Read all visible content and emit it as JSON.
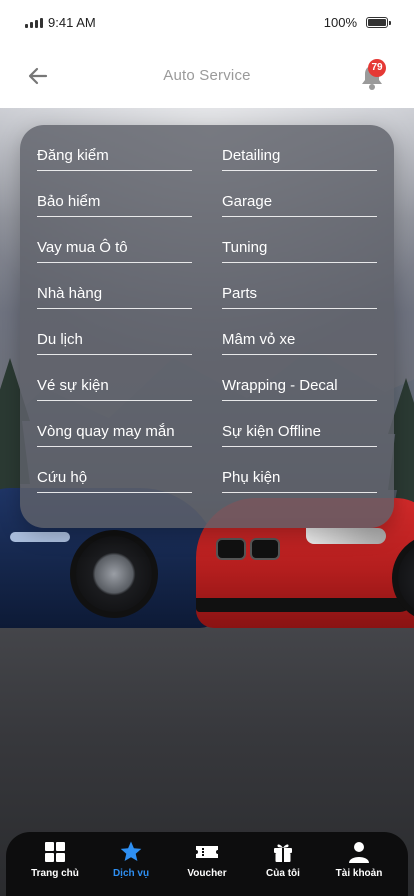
{
  "status_bar": {
    "time": "9:41 AM",
    "battery": "100%"
  },
  "header": {
    "title": "Auto Service",
    "notification_count": "79"
  },
  "services": {
    "left": [
      "Đăng kiểm",
      "Bảo hiểm",
      "Vay mua Ô tô",
      "Nhà hàng",
      "Du lịch",
      "Vé sự kiện",
      "Vòng quay may mắn",
      "Cứu hộ"
    ],
    "right": [
      "Detailing",
      "Garage",
      "Tuning",
      "Parts",
      "Mâm vỏ xe",
      "Wrapping - Decal",
      "Sự kiện Offline",
      "Phụ kiện"
    ]
  },
  "tabbar": {
    "items": [
      {
        "label": "Trang chủ",
        "icon": "grid-icon"
      },
      {
        "label": "Dịch vụ",
        "icon": "star-icon",
        "active": true
      },
      {
        "label": "Voucher",
        "icon": "ticket-icon"
      },
      {
        "label": "Của tôi",
        "icon": "gift-icon"
      },
      {
        "label": "Tài khoản",
        "icon": "user-icon"
      }
    ]
  },
  "colors": {
    "accent": "#2e8ff2",
    "badge": "#e53935",
    "tabbar": "#0d0d0e"
  }
}
